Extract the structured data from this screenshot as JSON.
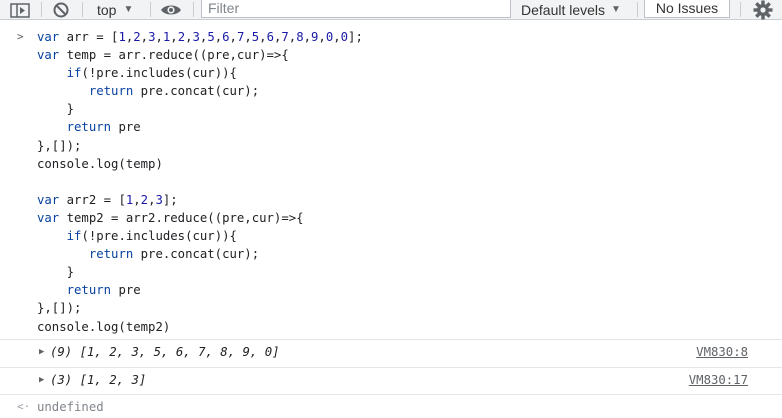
{
  "toolbar": {
    "context": "top",
    "filter_placeholder": "Filter",
    "levels": "Default levels",
    "issues": "No Issues"
  },
  "console_input": {
    "prompt": ">",
    "code_lines": [
      "var arr = [1,2,3,1,2,3,5,6,7,5,6,7,8,9,0,0];",
      "var temp = arr.reduce((pre,cur)=>{",
      "    if(!pre.includes(cur)){",
      "       return pre.concat(cur);",
      "    }",
      "    return pre",
      "},[]);",
      "console.log(temp)",
      "",
      "var arr2 = [1,2,3];",
      "var temp2 = arr2.reduce((pre,cur)=>{",
      "    if(!pre.includes(cur)){",
      "       return pre.concat(cur);",
      "    }",
      "    return pre",
      "},[]);",
      "console.log(temp2)"
    ]
  },
  "outputs": [
    {
      "count": "(9)",
      "values": "[1, 2, 3, 5, 6, 7, 8, 9, 0]",
      "source": "VM830:8"
    },
    {
      "count": "(3)",
      "values": "[1, 2, 3]",
      "source": "VM830:17"
    }
  ],
  "return_value": "undefined",
  "colors": {
    "toolbar_bg": "#f1f3f4",
    "keyword": "#0842a0",
    "number": "#1a1aa6",
    "link": "#5f6368"
  }
}
